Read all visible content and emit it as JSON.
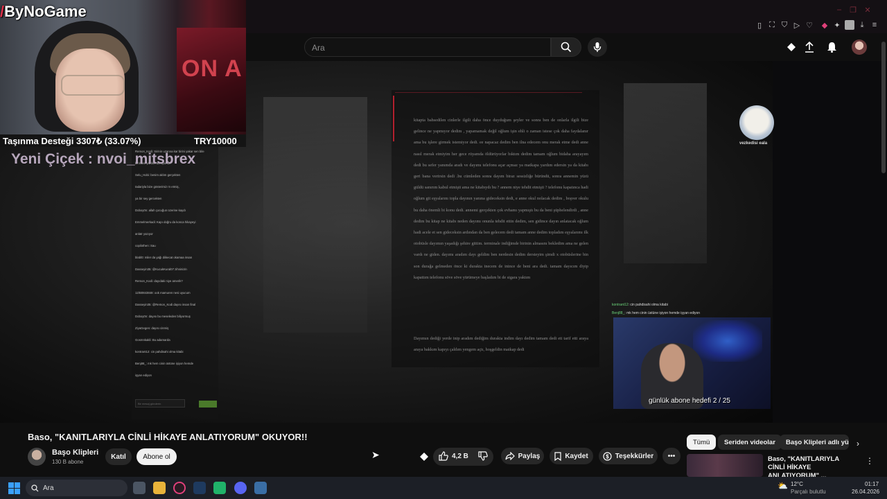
{
  "youtube": {
    "search_placeholder": "Ara",
    "video_title": "Baso, \"KANITLARIYLA CİNLİ HİKAYE ANLATIYORUM\" OKUYOR!!",
    "channel": {
      "name": "Başo Klipleri",
      "subscribers": "130 B abone"
    },
    "join_label": "Katıl",
    "subscribe_label": "Abone ol",
    "like_count": "4,2 B",
    "share_label": "Paylaş",
    "save_label": "Kaydet",
    "thanks_label": "Teşekkürler",
    "chips": [
      "Tümü",
      "Seriden videolar",
      "Başo Klipleri adlı yük"
    ],
    "recommended": {
      "title": "Baso, \"KANITLARIYLA CİNLİ HİKAYE ANLATIYORUM\" ..."
    }
  },
  "stream_overlay": {
    "logo": "ByNoGame",
    "goal_left": "Taşınma Desteği 3307₺ (33.07%)",
    "goal_right": "TRY10000",
    "follower_alert": "Yeni Çiçek : nvoi_mitsbrex",
    "mascot_label": "vezkedisi eala",
    "poster_text": "ON A",
    "cam_chat": [
      {
        "user": "kontrant12",
        "text": ": cin pahdisahi olma kitabi"
      },
      {
        "user": "Benj88_",
        "text": ": mk hem cinin üstüne işiyon hemde işyan ediyon"
      }
    ],
    "streamer_goal": "günlük abone hedefi 2 / 25"
  },
  "story": {
    "paragraph1": "kitapta bahsedilen cinlerle ilgili daha önce duyduğum şeyler ve sonra ben de onlarla ilgili bize gelince ne yapmıyor dedim , yapamamak değil oğlum işin ehli o zaman istese çok daha faydalanır ama bu işlere girmek istemiyor dedi. ee napacaz dedim ben ilna edecem onu merak etme dedi anne nasıl merak etmiyim her gece rüyamda öldürüyorlar bıktım dedim tamam oğlum bidaha arayayım dedi bu sefer yanımda aradı ve dayımı telefonu açar açmaz ya matkapa yardım edersin ya da kitabı geri bana verirsin dedi .bu cümleden sonra dayım biraz sessizliğe büründü, sonra annemin yüzü güldü sanırım kabul etmişti ama ne kitabıydı bu ? annem niye tehdit etmişti ? telefonu kapatınca hadi oğlum git eşyalarını topla dayının yanına gideceksin dedi, e anne okul nolacak dedim , boşver okulu bu daha önemli bi konu dedi. annemi gerçekten çok evhamı yapmıştı bu da beni şüphelendirdi , anne dedim bu kitap ne kitabı neden dayımı onunla tehdit ettin dedim, sen gidince dayın anlatacak oğlum hadi acele et sen gideceksin ardından da ben gelecem dedi tamam anne dedim topladım eşyalarımı ilk otobüsle dayımın yaşadığı şehire gittim. terminale indiğimde birinin almasını bekledim ama ne gelen vardı ne giden. dayımı aradım dayı geldim ben nerdesin dedim dersteyim şimdi x otobüslerine bin son durağa gelmeden önce ki durakta inecem de inince de beni ara dedi. tamam dayıcım diyip kapattım telefonu söve söve yürümeye başladım bi de sigara yaktım",
    "paragraph2": "Dayımın dediği yerde inip aradım dediğim durakta indim dayı dedim tamam dedi eti tarif etti araya araya bakkım kapıyı çaldım yengem açtı, hoşgeldin matkap dedi"
  },
  "chat_lines": [
    "Remon_Kodi: Sirinin uzanna kar birini yakar sen bile",
    "birinden yardım almışsındır",
    "Selu_Hobi: benim aklım gerçekten",
    "tadariyla bize gösterimiz rn etmiş,",
    "ya bir sey gercekten",
    "Doboy0n: allah çocuğun üzerine kaydı",
    "Emmelmerkadi: Kapı doğru da konca hikayeyi",
    "anlatr yazıyor",
    "copilothen: Sau",
    "blabl0: miler da yağı diikecat okamaa insan",
    "Dasseyin35: @KucukKural07 zihninizin",
    "Remon_Kodi: dayıdaki niye amerik?",
    "12/B0843848: ook mamuren nesi uyucum",
    "Dasseyin35: @Remon_Kodi dayısı insan final",
    "Doboy0n: dayısı bu meseleden biliyormuş",
    "ZiyaGegen: dayısı cinmiş",
    "Gosmnkakli: Bu adamarda",
    "kontrant12: cin pahdisahi olma kitabi",
    "Benj88_: mk hem cinin üstüne işiyon hemde",
    "işyan ediyon"
  ],
  "chat_input_placeholder": "Bir mesaj gönderin",
  "taskbar": {
    "search_placeholder": "Ara",
    "weather_temp": "12°C",
    "weather_desc": "Parçalı bulutlu",
    "time": "01:17",
    "date": "26.04.2026"
  },
  "colors": {
    "accent_red": "#b3202e",
    "chat_user": "#b07cd6",
    "cam_chat_user": "#6bd47a"
  }
}
